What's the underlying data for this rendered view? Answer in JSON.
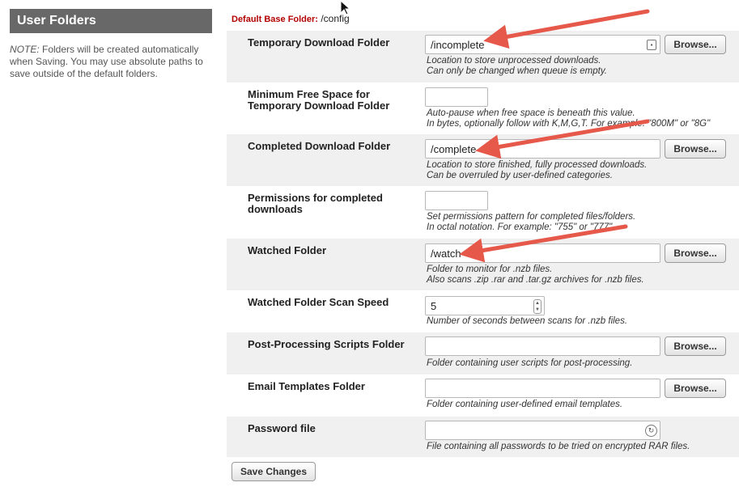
{
  "sidebar": {
    "title": "User Folders",
    "note_prefix": "NOTE:",
    "note_text": " Folders will be created automatically when Saving. You may use absolute paths to save outside of the default folders."
  },
  "base_folder": {
    "label": "Default Base Folder:",
    "value": "/config"
  },
  "rows": [
    {
      "label": "Temporary Download Folder",
      "value": "/incomplete",
      "button": "Browse...",
      "help": [
        "Location to store unprocessed downloads.",
        "Can only be changed when queue is empty."
      ]
    },
    {
      "label": "Minimum Free Space for Temporary Download Folder",
      "value": "",
      "help": [
        "Auto-pause when free space is beneath this value.",
        "In bytes, optionally follow with K,M,G,T. For example: \"800M\" or \"8G\""
      ]
    },
    {
      "label": "Completed Download Folder",
      "value": "/complete",
      "button": "Browse...",
      "help": [
        "Location to store finished, fully processed downloads.",
        "Can be overruled by user-defined categories."
      ]
    },
    {
      "label": "Permissions for completed downloads",
      "value": "",
      "help": [
        "Set permissions pattern for completed files/folders.",
        "In octal notation. For example: \"755\" or \"777\""
      ]
    },
    {
      "label": "Watched Folder",
      "value": "/watch",
      "button": "Browse...",
      "help": [
        "Folder to monitor for .nzb files.",
        "Also scans .zip .rar and .tar.gz archives for .nzb files."
      ]
    },
    {
      "label": "Watched Folder Scan Speed",
      "value": "5",
      "help": [
        "Number of seconds between scans for .nzb files."
      ]
    },
    {
      "label": "Post-Processing Scripts Folder",
      "value": "",
      "button": "Browse...",
      "help": [
        "Folder containing user scripts for post-processing."
      ]
    },
    {
      "label": "Email Templates Folder",
      "value": "",
      "button": "Browse...",
      "help": [
        "Folder containing user-defined email templates."
      ]
    },
    {
      "label": "Password file",
      "value": "",
      "help": [
        "File containing all passwords to be tried on encrypted RAR files."
      ]
    }
  ],
  "save_button": "Save Changes",
  "colors": {
    "sidebar_header_bg": "#686868",
    "row_shade": "#f0f0f0",
    "base_label": "#b30000",
    "annotation_arrow": "#e5584a"
  }
}
